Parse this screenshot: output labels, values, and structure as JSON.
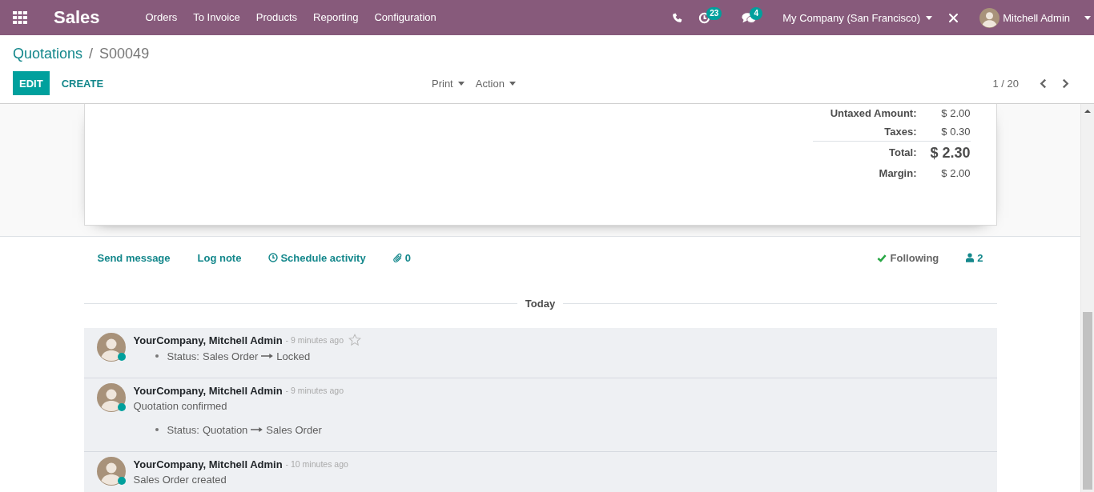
{
  "navbar": {
    "app_name": "Sales",
    "menu": [
      "Orders",
      "To Invoice",
      "Products",
      "Reporting",
      "Configuration"
    ],
    "activity_badge": "23",
    "message_badge": "4",
    "company": "My Company (San Francisco)",
    "user": "Mitchell Admin"
  },
  "breadcrumb": {
    "items": [
      {
        "label": "Quotations",
        "active": false
      },
      {
        "label": "S00049",
        "active": true
      }
    ],
    "separator": "/"
  },
  "buttons": [
    {
      "label": "EDIT",
      "kind": "primary"
    },
    {
      "label": "CREATE",
      "kind": "secondary"
    }
  ],
  "dropdowns": [
    "Print",
    "Action"
  ],
  "pager": "1 / 20",
  "totals": [
    {
      "label": "Untaxed Amount:",
      "value": "$ 2.00",
      "kind": "normal"
    },
    {
      "label": "Taxes:",
      "value": "$ 0.30",
      "kind": "normal"
    },
    {
      "label": "Total:",
      "value": "$ 2.30",
      "kind": "total"
    },
    {
      "label": "Margin:",
      "value": "$ 2.00",
      "kind": "normal"
    }
  ],
  "chatter": {
    "actions": [
      {
        "label": "Send message",
        "kind": "link"
      },
      {
        "label": "Log note",
        "kind": "link"
      },
      {
        "label": "Schedule activity",
        "kind": "activity"
      },
      {
        "label": "0",
        "kind": "attachments"
      }
    ],
    "following": "Following",
    "followers": "2",
    "separator": "Today",
    "messages": [
      {
        "author": "YourCompany, Mitchell Admin",
        "date": "- 9 minutes ago",
        "online": true,
        "starred": false,
        "tracking": [
          {
            "field": "Status:",
            "old": "Sales Order",
            "new": "Locked"
          }
        ]
      },
      {
        "author": "YourCompany, Mitchell Admin",
        "date": "- 9 minutes ago",
        "online": true,
        "body": "Quotation confirmed",
        "tracking": [
          {
            "field": "Status:",
            "old": "Quotation",
            "new": "Sales Order"
          }
        ]
      },
      {
        "author": "YourCompany, Mitchell Admin",
        "date": "- 10 minutes ago",
        "online": true,
        "body": "Sales Order created"
      }
    ]
  }
}
